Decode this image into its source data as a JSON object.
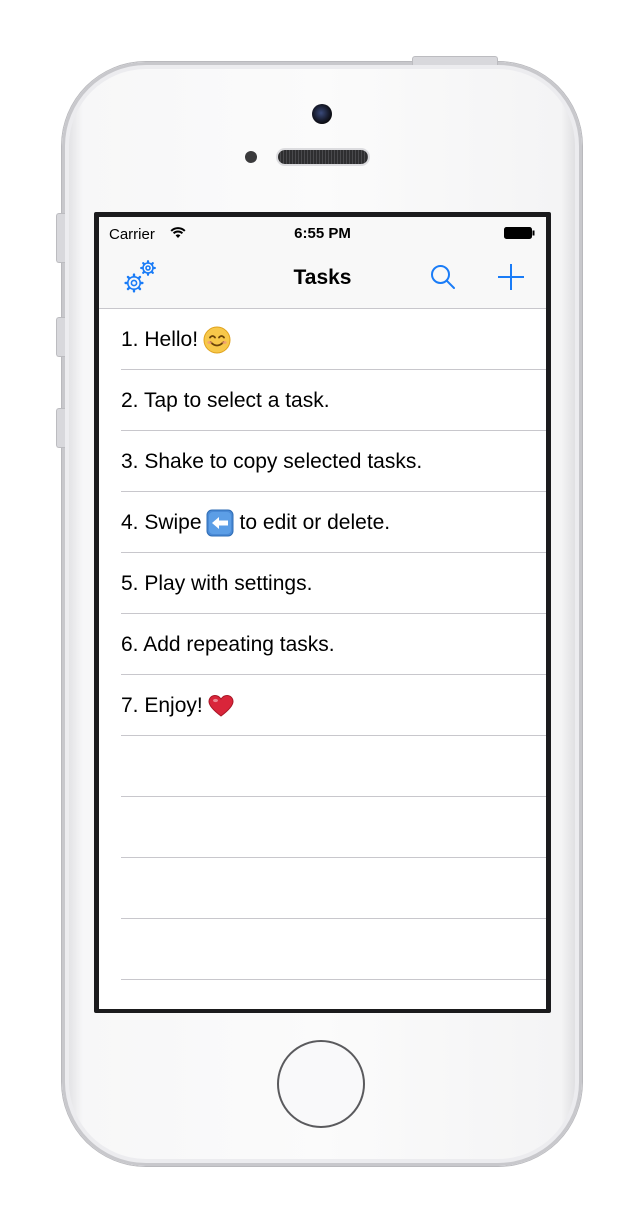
{
  "status_bar": {
    "carrier": "Carrier",
    "time": "6:55 PM"
  },
  "nav_bar": {
    "title": "Tasks",
    "left_icon": "settings-gears-icon",
    "right_icons": [
      "search-icon",
      "add-icon"
    ]
  },
  "tasks": {
    "items": [
      {
        "text": "1. Hello!",
        "emoji": "smiling-face-emoji"
      },
      {
        "text": "2. Tap to select a task."
      },
      {
        "text": "3. Shake to copy selected tasks."
      },
      {
        "text_before": "4. Swipe",
        "text_after": "to edit or delete.",
        "emoji": "left-arrow-emoji"
      },
      {
        "text": "5. Play with settings."
      },
      {
        "text": "6. Add repeating tasks."
      },
      {
        "text": "7. Enjoy!",
        "emoji": "red-heart-emoji"
      }
    ]
  },
  "colors": {
    "accent": "#1a7cf7",
    "separator": "#c8c7cc",
    "bar_background": "#f8f8f8"
  }
}
